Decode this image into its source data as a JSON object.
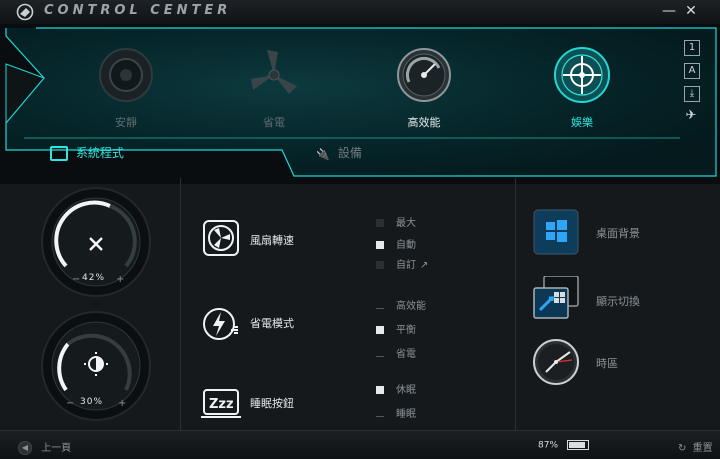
{
  "window": {
    "title": "CONTROL CENTER",
    "minimize": "—",
    "close": "✕"
  },
  "modes": [
    {
      "label": "安靜",
      "active": false
    },
    {
      "label": "省電",
      "active": false
    },
    {
      "label": "高效能",
      "active": false
    },
    {
      "label": "娛樂",
      "active": true
    }
  ],
  "side_icons": [
    "1",
    "A",
    "⤓",
    "✈"
  ],
  "tabs": {
    "system": "系統程式",
    "devices": "設備"
  },
  "gauges": [
    {
      "value": "42%"
    },
    {
      "value": "30%"
    }
  ],
  "features": {
    "fan": {
      "label": "風扇轉速",
      "options": [
        "最大",
        "自動",
        "自訂"
      ],
      "selected": "自動"
    },
    "power": {
      "label": "省電模式",
      "options": [
        "高效能",
        "平衡",
        "省電"
      ],
      "selected": "平衡"
    },
    "sleep": {
      "label": "睡眠按鈕",
      "options": [
        "休眠",
        "睡眠"
      ],
      "selected": "休眠"
    }
  },
  "right_items": {
    "desktop": "桌面背景",
    "display": "顯示切換",
    "timezone": "時區"
  },
  "footer": {
    "back": "上一頁",
    "battery": "87%",
    "reset": "重置"
  },
  "colors": {
    "accent": "#1ed8d4",
    "panel": "#06262a"
  }
}
